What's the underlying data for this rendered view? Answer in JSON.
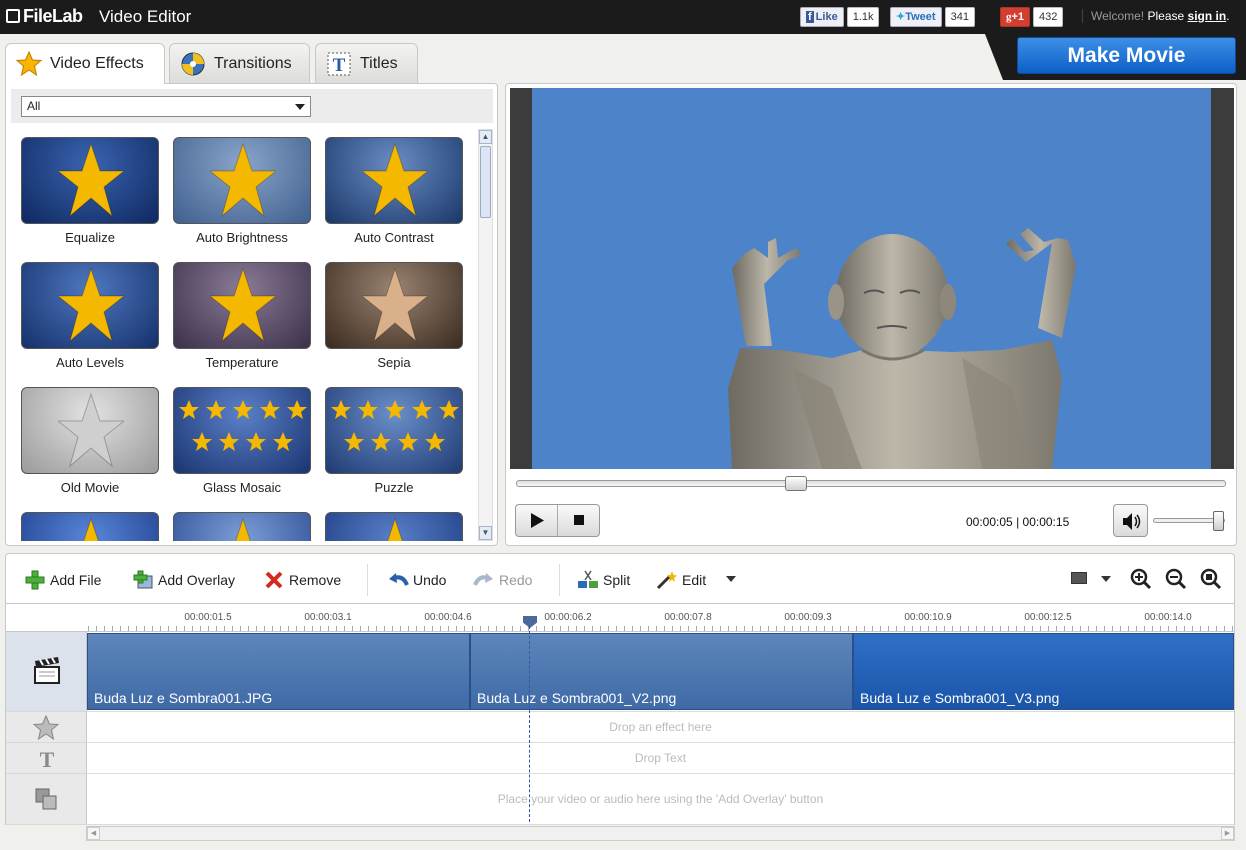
{
  "app": {
    "logo": "FileLab",
    "title": "Video Editor"
  },
  "social": {
    "facebook": {
      "label": "Like",
      "count": "1.1k"
    },
    "twitter": {
      "label": "Tweet",
      "count": "341"
    },
    "google": {
      "label": "+1",
      "count": "432"
    }
  },
  "account": {
    "welcome": "Welcome!",
    "please": "Please",
    "signin": "sign in",
    "dot": "."
  },
  "make_movie": "Make Movie",
  "tabs": [
    {
      "label": "Video Effects",
      "icon": "star-icon"
    },
    {
      "label": "Transitions",
      "icon": "transitions-icon"
    },
    {
      "label": "Titles",
      "icon": "titles-icon"
    }
  ],
  "filter": {
    "selected": "All"
  },
  "effects": [
    {
      "label": "Equalize",
      "icon": "star-icon"
    },
    {
      "label": "Auto Brightness",
      "icon": "star-icon"
    },
    {
      "label": "Auto Contrast",
      "icon": "star-icon"
    },
    {
      "label": "Auto Levels",
      "icon": "star-icon"
    },
    {
      "label": "Temperature",
      "icon": "star-icon"
    },
    {
      "label": "Sepia",
      "icon": "star-icon"
    },
    {
      "label": "Old Movie",
      "icon": "star-icon"
    },
    {
      "label": "Glass Mosaic",
      "icon": "mosaic-icon"
    },
    {
      "label": "Puzzle",
      "icon": "puzzle-icon"
    },
    {
      "label": "",
      "icon": "star-icon"
    },
    {
      "label": "",
      "icon": "star-icon"
    },
    {
      "label": "",
      "icon": "star-icon"
    }
  ],
  "player": {
    "current_time": "00:00:05",
    "separator": "|",
    "total_time": "00:00:15",
    "seek_fraction": 0.39,
    "volume_fraction": 0.95
  },
  "toolbar": {
    "add_file": "Add File",
    "add_overlay": "Add Overlay",
    "remove": "Remove",
    "undo": "Undo",
    "redo": "Redo",
    "split": "Split",
    "edit": "Edit"
  },
  "ruler": {
    "labels": [
      "00:00:01.5",
      "00:00:03.1",
      "00:00:04.6",
      "00:00:06.2",
      "00:00:07.8",
      "00:00:09.3",
      "00:00:10.9",
      "00:00:12.5",
      "00:00:14.0"
    ]
  },
  "timeline": {
    "clips": [
      {
        "name": "Buda Luz e Sombra001.JPG"
      },
      {
        "name": "Buda Luz e Sombra001_V2.png"
      },
      {
        "name": "Buda Luz e Sombra001_V3.png"
      }
    ],
    "effect_hint": "Drop an effect here",
    "text_hint": "Drop Text",
    "overlay_hint": "Place your video or audio here using the 'Add Overlay' button"
  },
  "colors": {
    "accent": "#1e6fd4",
    "clip": "#4a75ae",
    "topbar": "#1b1b1b"
  }
}
